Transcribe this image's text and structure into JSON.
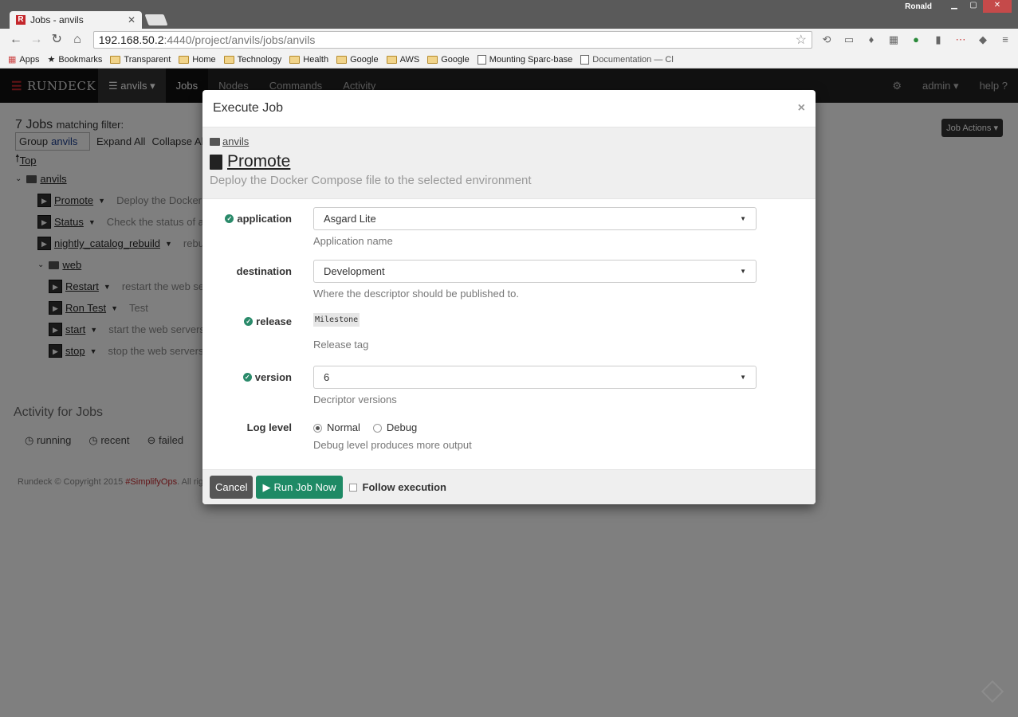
{
  "browser": {
    "user": "Ronald",
    "tab_title": "Jobs - anvils",
    "url_host": "192.168.50.2",
    "url_path": ":4440/project/anvils/jobs/anvils",
    "bookmarks": [
      "Apps",
      "Bookmarks",
      "Transparent",
      "Home",
      "Technology",
      "Health",
      "Google",
      "AWS",
      "Google",
      "Mounting Sparc-base",
      "Documentation — Cl"
    ]
  },
  "navbar": {
    "brand": "RUNDECK",
    "project": "anvils",
    "items": [
      "Jobs",
      "Nodes",
      "Commands",
      "Activity"
    ],
    "user": "admin",
    "help": "help"
  },
  "jobs_page": {
    "count": "7 Jobs",
    "matching": "matching filter:",
    "group_label": "Group",
    "group_value": "anvils",
    "expand_all": "Expand All",
    "collapse_all": "Collapse All",
    "top_link": "Top",
    "job_actions": "Job Actions",
    "tree": [
      {
        "type": "folder",
        "name": "anvils",
        "indent": 0
      },
      {
        "type": "job",
        "name": "Promote",
        "desc": "Deploy the Docker C",
        "indent": 1
      },
      {
        "type": "job",
        "name": "Status",
        "desc": "Check the status of an",
        "indent": 1
      },
      {
        "type": "job",
        "name": "nightly_catalog_rebuild",
        "desc": "rebuil",
        "indent": 1
      },
      {
        "type": "folder",
        "name": "web",
        "indent": 1
      },
      {
        "type": "job",
        "name": "Restart",
        "desc": "restart the web serv",
        "indent": 2
      },
      {
        "type": "job",
        "name": "Ron Test",
        "desc": "Test",
        "indent": 2
      },
      {
        "type": "job",
        "name": "start",
        "desc": "start the web servers",
        "indent": 2
      },
      {
        "type": "job",
        "name": "stop",
        "desc": "stop the web servers",
        "indent": 2
      }
    ],
    "activity_title": "Activity for Jobs",
    "activity_tabs": [
      "running",
      "recent",
      "failed"
    ],
    "footer": "Rundeck © Copyright 2015 ",
    "footer_link": "#SimplifyOps",
    "footer_tail": ". All righ"
  },
  "modal": {
    "title": "Execute Job",
    "close": "×",
    "breadcrumb": "anvils",
    "job_name": "Promote",
    "job_desc": "Deploy the Docker Compose file to the selected environment",
    "options": {
      "application": {
        "label": "application",
        "value": "Asgard Lite",
        "help": "Application name"
      },
      "destination": {
        "label": "destination",
        "value": "Development",
        "help": "Where the descriptor should be published to."
      },
      "release": {
        "label": "release",
        "value": "Milestone",
        "help": "Release tag"
      },
      "version": {
        "label": "version",
        "value": "6",
        "help": "Decriptor versions"
      }
    },
    "log_level": {
      "label": "Log level",
      "normal": "Normal",
      "debug": "Debug",
      "help": "Debug level produces more output"
    },
    "cancel": "Cancel",
    "run": "Run Job Now",
    "follow": "Follow execution"
  }
}
